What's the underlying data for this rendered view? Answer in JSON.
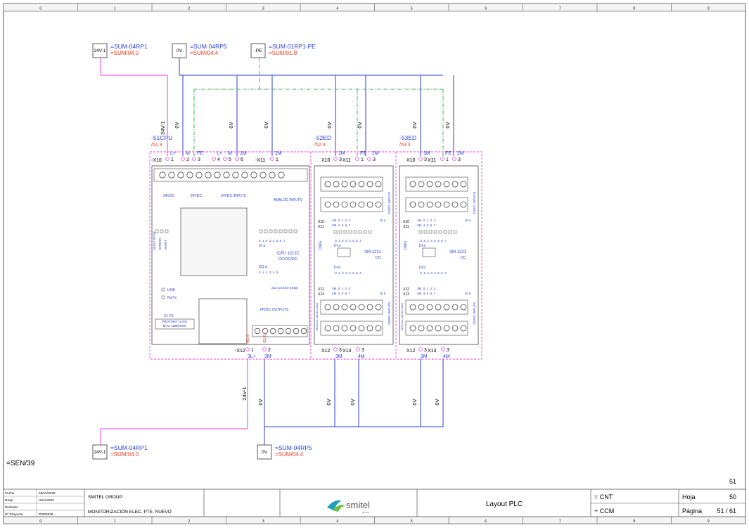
{
  "colors": {
    "blue": "#2c3fd6",
    "red": "#e8402a",
    "magenta": "#ef3ce0",
    "green": "#39b54a",
    "frame": "#333333",
    "teal": "#1aa0b8"
  },
  "grid": [
    "0",
    "1",
    "2",
    "3",
    "4",
    "5",
    "6",
    "7",
    "8",
    "9"
  ],
  "sources": {
    "top_24v": {
      "box": "24V-1",
      "name": "=SUM-04RP1",
      "ref": "=SUM/04.0"
    },
    "top_0v": {
      "box": "0V",
      "name": "=SUM-04RP5",
      "ref": "=SUM/04.4"
    },
    "top_pe": {
      "box": "-PE",
      "name": "=SUM-01RP1-PE",
      "ref": "=SUM/01.8"
    },
    "bot_24v": {
      "box": "24V-1",
      "name": "=SUM-04RP1",
      "ref": "=SUM/04.0"
    },
    "bot_0v": {
      "box": "0V",
      "name": "=SUM-04RP5",
      "ref": "=SUM/04.4"
    }
  },
  "wire_labels": {
    "w24": "24V-1",
    "w0": "0V"
  },
  "devices": {
    "cpu": {
      "tag": "-51CPU",
      "ref": "/51.3",
      "x10": "-X10",
      "x11": "-X11",
      "x12": "-X12",
      "top_terms": [
        "L+",
        "M",
        "FE",
        "L+",
        "M",
        "1M",
        "2M"
      ],
      "top_nums": [
        "1",
        "2",
        "3",
        "4",
        "5",
        "6",
        "1"
      ],
      "bot_terms": [
        "3L+",
        "3M"
      ],
      "bot_nums": [
        "1",
        "2"
      ],
      "red_refs": [
        "/51.3",
        "/51.3",
        "/51.3",
        "/51.3",
        "/51.3",
        "/51.3",
        "/51.6"
      ],
      "red_bot": [
        "/51.6",
        "/51.6"
      ],
      "hdr_l": "24VDC",
      "hdr_m": "24VDC",
      "inputs": "24VDC INPUTS",
      "analog": "ANALOG INPUTS",
      "dia": "DI a",
      "model": "CPU 1212C",
      "variant": "DC/DC/DC",
      "dqa": "DQ a",
      "order": "212-1AE40-0XB0",
      "link": "LINK",
      "rxtx": "Rx/Tx",
      "port": "X1 P1",
      "profinet": "PROFINET (LAN)",
      "mac": "MAC ADDRESS",
      "outputs": "24VDC OUTPUTS",
      "run": "RUN / STOP",
      "error": "ERROR",
      "maint": "MAINT",
      "di_bits": "0 .1 .2 .3 .4 .5 .6 .7",
      "dq_bits": "0 .1 .2 .3 .4 .5"
    },
    "ed52": {
      "tag": "-52ED",
      "ref": "/52.3",
      "x10": "X10",
      "x11": "X11",
      "x12": "X12",
      "x13": "X13",
      "top": [
        "1M",
        "FE",
        "2M"
      ],
      "nums": [
        "3",
        "1",
        "3"
      ],
      "bot": [
        "3M",
        "4M"
      ],
      "botnums": [
        "3",
        "3"
      ],
      "model": "SM 1221",
      "variant": "DC",
      "dia": "DI a",
      "dib": "DI b",
      "diag": "DIAG",
      "inputs": "24VDC INPUTS",
      "order": "6ES7221-1BH32-0XB0",
      "red": "/52.3"
    },
    "ed53": {
      "tag": "-53ED",
      "ref": "/53.3",
      "x10": "X10",
      "x11": "X11",
      "x12": "X12",
      "x13": "X13",
      "top": [
        "1M",
        "FE",
        "2M"
      ],
      "nums": [
        "3",
        "1",
        "3"
      ],
      "bot": [
        "3M",
        "4M"
      ],
      "botnums": [
        "3",
        "3"
      ],
      "model": "SM 1221",
      "variant": "DC",
      "dia": "DI a",
      "dib": "DI b",
      "diag": "DIAG",
      "inputs": "24VDC INPUTS",
      "order": "6ES7221-1BH32-0XB0",
      "red": "/53.3"
    }
  },
  "sen_ref": "=SEN/39",
  "page_num": "51",
  "title_block": {
    "fecha_l": "Fecha",
    "fecha": "25/11/2025",
    "resp_l": "Resp",
    "resp": "USUARIO",
    "probado_l": "Probado",
    "probado": "",
    "proy_l": "Nº Proyecto",
    "proy": "PI250236 -",
    "company": "SMITEL GROUP",
    "project": "MONITORIZACIÓN ELEC. PTE. NUEVO",
    "logo": "smitel",
    "logo_sub": "group",
    "title": "Layout PLC",
    "loc1": "= CNT",
    "loc2": "+ CCM",
    "hoja_l": "Hoja",
    "hoja": "50",
    "pagina_l": "Página",
    "pagina": "51 / 61"
  }
}
